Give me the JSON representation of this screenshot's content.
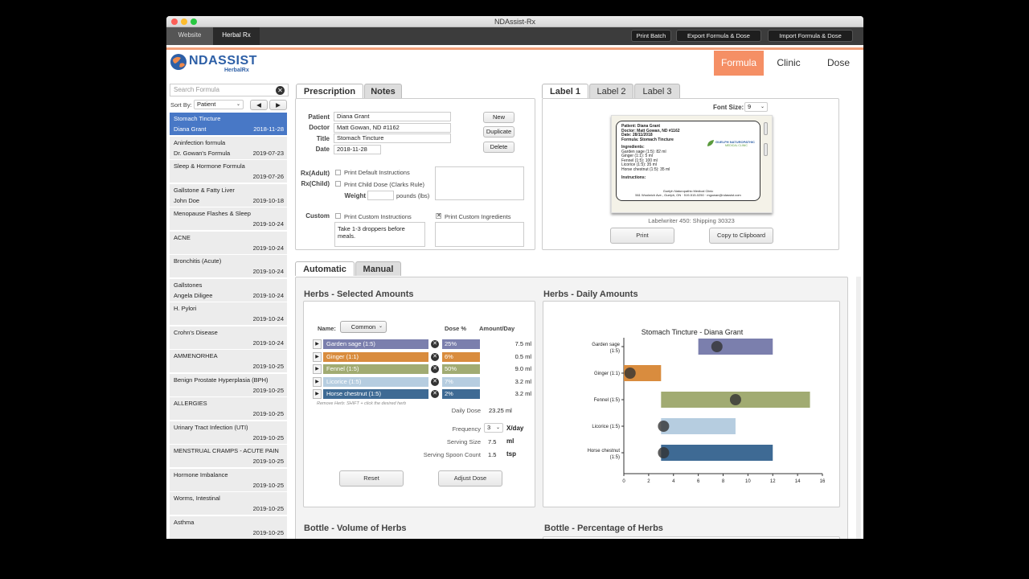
{
  "window": {
    "title": "NDAssist-Rx"
  },
  "toolbar": {
    "tabs": [
      "Website",
      "Herbal Rx"
    ],
    "buttons": [
      "Print Batch",
      "Export Formula & Dose",
      "Import Formula & Dose"
    ]
  },
  "header": {
    "logo_text": "NDASSIST",
    "logo_sub": "HerbalRx",
    "nav": [
      "Formula",
      "Clinic",
      "Dose"
    ],
    "active_nav": "Formula"
  },
  "sidebar": {
    "search_placeholder": "Search Formula",
    "sort_label": "Sort By:",
    "sort_value": "Patient",
    "items": [
      {
        "name": "Stomach Tincture",
        "patient": "Diana Grant",
        "date": "2018-11-28",
        "selected": true
      },
      {
        "name": "Aninfection formula",
        "patient": "Dr. Gowan's Formula",
        "date": "2019-07-23"
      },
      {
        "name": "Sleep & Hormone Formula",
        "patient": "",
        "date": "2019-07-26"
      },
      {
        "name": "Gallstone & Fatty Liver",
        "patient": "John Doe",
        "date": "2019-10-18"
      },
      {
        "name": "Menopause Flashes & Sleep",
        "patient": "",
        "date": "2019-10-24"
      },
      {
        "name": "ACNE",
        "patient": "",
        "date": "2019-10-24"
      },
      {
        "name": "Bronchitis (Acute)",
        "patient": "",
        "date": "2019-10-24"
      },
      {
        "name": "Gallstones",
        "patient": "Angela Diligee",
        "date": "2019-10-24"
      },
      {
        "name": "H. Pylori",
        "patient": "",
        "date": "2019-10-24"
      },
      {
        "name": "Crohn's Disease",
        "patient": "",
        "date": "2019-10-24"
      },
      {
        "name": "AMMENORHEA",
        "patient": "",
        "date": "2019-10-25"
      },
      {
        "name": "Benign Prostate Hyperplasia (BPH)",
        "patient": "",
        "date": "2019-10-25"
      },
      {
        "name": "ALLERGIES",
        "patient": "",
        "date": "2019-10-25"
      },
      {
        "name": "Urinary Tract Infection (UTI)",
        "patient": "",
        "date": "2019-10-25"
      },
      {
        "name": "MENSTRUAL CRAMPS - ACUTE PAIN",
        "patient": "",
        "date": "2019-10-25"
      },
      {
        "name": "Hormone Imbalance",
        "patient": "",
        "date": "2019-10-25"
      },
      {
        "name": "Worms, Intestinal",
        "patient": "",
        "date": "2019-10-25"
      },
      {
        "name": "Asthma",
        "patient": "",
        "date": "2019-10-25"
      }
    ]
  },
  "prescription": {
    "tabs": [
      "Prescription",
      "Notes"
    ],
    "labels": {
      "patient": "Patient",
      "doctor": "Doctor",
      "title": "Title",
      "date": "Date",
      "rx_adult": "Rx(Adult)",
      "rx_child": "Rx(Child)",
      "weight": "Weight",
      "custom": "Custom"
    },
    "patient": "Diana Grant",
    "doctor": "Matt Gowan, ND #1162",
    "title": "Stomach Tincture",
    "date": "2018-11-28",
    "buttons": [
      "New",
      "Duplicate",
      "Delete"
    ],
    "print_default": "Print Default Instructions",
    "print_child": "Print Child Dose (Clarks Rule)",
    "weight_unit": "pounds (lbs)",
    "print_custom_instr": "Print Custom Instructions",
    "print_custom_ingr": "Print Custom Ingredients",
    "custom_text": "Take 1-3 droppers before meals."
  },
  "label": {
    "tabs": [
      "Label 1",
      "Label 2",
      "Label 3"
    ],
    "font_size_label": "Font Size:",
    "font_size": "9",
    "preview": {
      "patient": "Patient: Diana Grant",
      "doctor": "Doctor: Matt Gowan, ND #1162",
      "date": "Date: 28/11/2018",
      "formula": "Formula: Stomach Tincture",
      "ingredients_title": "Ingredients:",
      "ingredients": [
        "Garden sage (1:5): 82 ml",
        "Ginger (1:1): 5 ml",
        "Fennel (1:5): 100 ml",
        "Licorice (1:5): 35 ml",
        "Horse chestnut (1:5): 35 ml"
      ],
      "instructions_title": "Instructions:",
      "clinic_name": "GUELPH NATUROPATHIC",
      "clinic_sub": "MEDICAL CLINIC",
      "footer1": "Guelph Naturopathic Medical Clinic",
      "footer2": "561 Woolwich Ave., Guelph, ON · 519-515-0250 · mgowan@ndassist.com"
    },
    "printer": "Labelwriter 450: Shipping 30323",
    "buttons": [
      "Print",
      "Copy to Clipboard"
    ]
  },
  "dose": {
    "tabs": [
      "Automatic",
      "Manual"
    ],
    "selected_title": "Herbs - Selected Amounts",
    "daily_title": "Herbs - Daily Amounts",
    "name_label": "Name:",
    "name_value": "Common",
    "col_dose": "Dose %",
    "col_amount": "Amount/Day",
    "herbs": [
      {
        "name": "Garden sage (1:5)",
        "pct": "25%",
        "amount": "7.5 ml",
        "color": "#7b7fad"
      },
      {
        "name": "Ginger (1:1)",
        "pct": "6%",
        "amount": "0.5 ml",
        "color": "#d98c3e"
      },
      {
        "name": "Fennel (1:5)",
        "pct": "50%",
        "amount": "9.0 ml",
        "color": "#a1ab72"
      },
      {
        "name": "Licorice (1:5)",
        "pct": "7%",
        "amount": "3.2 ml",
        "color": "#b6cde0"
      },
      {
        "name": "Horse chestnut (1:5)",
        "pct": "2%",
        "amount": "3.2 ml",
        "color": "#3e6a94"
      }
    ],
    "remove_hint": "Remove Herb: SHIFT + click the desired herb",
    "daily_dose_label": "Daily Dose",
    "daily_dose": "23.25 ml",
    "frequency_label": "Frequency",
    "frequency": "3",
    "frequency_unit": "X/day",
    "serving_size_label": "Serving Size",
    "serving_size": "7.5",
    "serving_size_unit": "ml",
    "spoon_label": "Serving Spoon Count",
    "spoon": "1.5",
    "spoon_unit": "tsp",
    "buttons": [
      "Reset",
      "Adjust Dose"
    ],
    "bottle_volume_title": "Bottle - Volume of Herbs",
    "bottle_pct_title": "Bottle - Percentage of Herbs"
  },
  "chart_data": {
    "type": "bar",
    "title": "Stomach Tincture - Diana Grant",
    "categories": [
      "Garden sage (1:5)",
      "Ginger (1:1)",
      "Fennel (1:5)",
      "Licorice (1:5)",
      "Horse chestnut (1:5)"
    ],
    "series": [
      {
        "range_start": [
          6,
          0,
          3,
          3,
          3
        ],
        "range_end": [
          12,
          3,
          15,
          9,
          12
        ],
        "points": [
          7.5,
          0.5,
          9.0,
          3.2,
          3.2
        ]
      }
    ],
    "colors": [
      "#7b7fad",
      "#d98c3e",
      "#a1ab72",
      "#b6cde0",
      "#3e6a94"
    ],
    "xlim": [
      0,
      16
    ],
    "xticks": [
      0,
      2,
      4,
      6,
      8,
      10,
      12,
      14,
      16
    ]
  }
}
